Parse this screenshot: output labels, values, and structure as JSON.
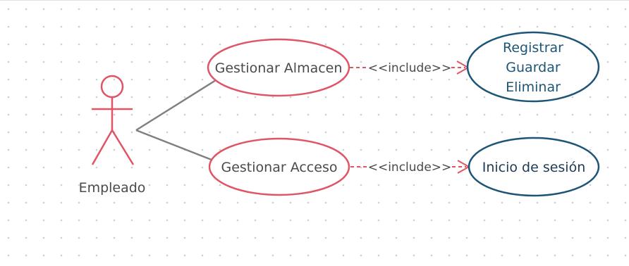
{
  "diagram": {
    "actor": {
      "name": "Empleado"
    },
    "use_cases": {
      "gestionar_almacen": "Gestionar Almacen",
      "gestionar_acceso": "Gestionar Acceso",
      "registrar": {
        "lines": [
          "Registrar",
          "Guardar",
          "Eliminar"
        ]
      },
      "inicio_sesion": "Inicio de sesión"
    },
    "relations": {
      "include_1": "<<include>>",
      "include_2": "<<include>>"
    }
  },
  "colors": {
    "actor_stroke": "#e05565",
    "primary_use_case_stroke": "#e05565",
    "included_use_case_stroke": "#1d5577",
    "included_text": "#1d5577",
    "association_line": "#808080",
    "include_arrow": "#e05565",
    "text": "#4a4a4a",
    "grid_dot": "#cfcfcf"
  },
  "icons": {
    "actor": "stick-figure-icon"
  }
}
